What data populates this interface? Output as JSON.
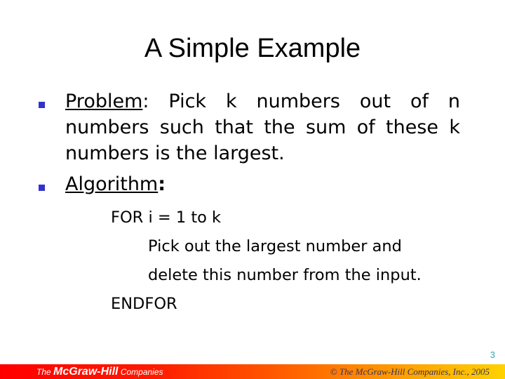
{
  "slide": {
    "title": "A Simple Example",
    "bullets": [
      {
        "label": "Problem",
        "colon": ":",
        "text": " Pick k numbers out of n numbers such that the sum of these k numbers is the largest."
      },
      {
        "label": "Algorithm",
        "colon": ":"
      }
    ],
    "algorithm_lines": [
      "FOR i = 1 to k",
      "Pick out the largest number and",
      "delete this number from the input.",
      "ENDFOR"
    ],
    "page_number": "3"
  },
  "footer": {
    "logo_prefix": "The ",
    "logo_brand": "McGraw-Hill",
    "logo_suffix": " Companies",
    "copyright": "© The McGraw-Hill Companies, Inc., 2005"
  },
  "colors": {
    "bullet": "#3333cc",
    "page_number": "#33aaaa"
  }
}
